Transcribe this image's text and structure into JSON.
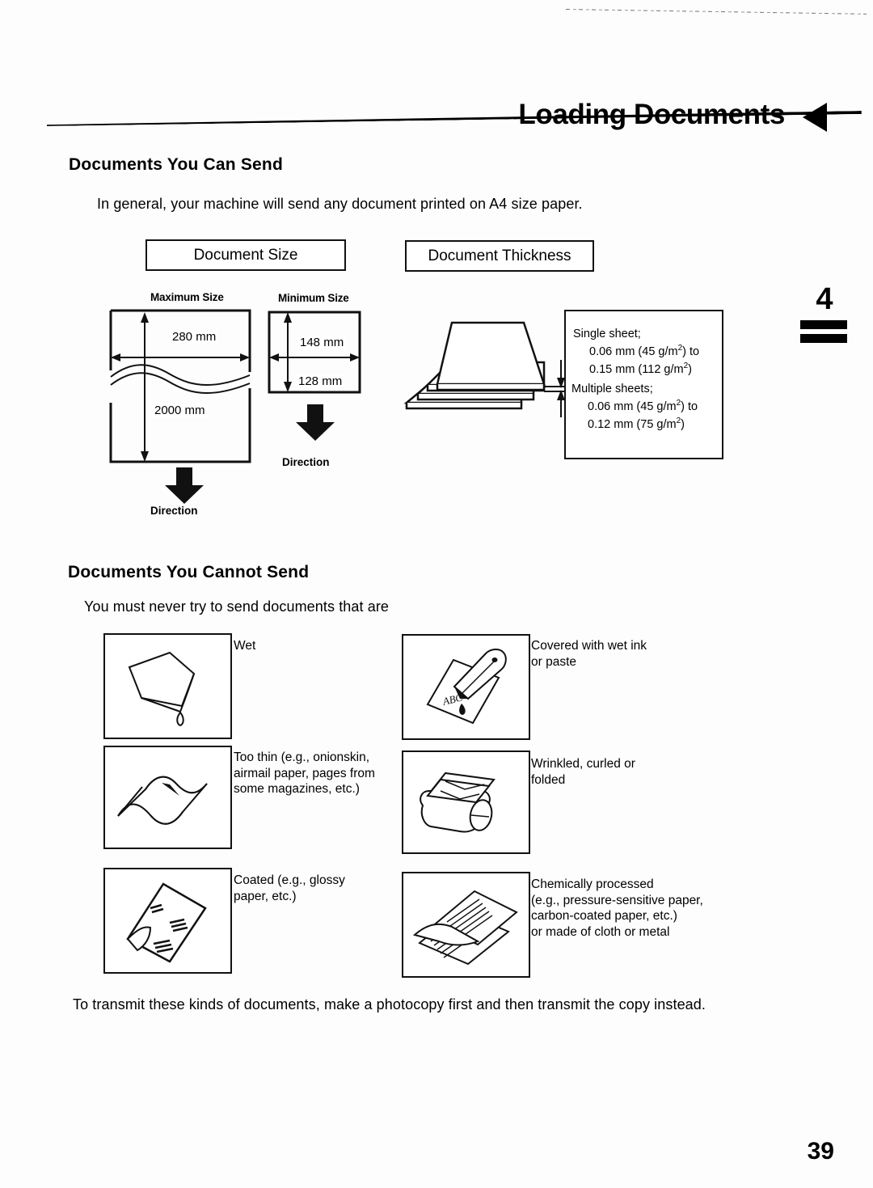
{
  "page": {
    "header_title": "Loading Documents",
    "chapter_number": "4",
    "page_number": "39"
  },
  "can_send": {
    "heading": "Documents You Can Send",
    "intro": "In general, your machine will send any document printed on A4 size paper.",
    "document_size": {
      "label": "Document Size",
      "maximum": {
        "caption": "Maximum Size",
        "width": "280 mm",
        "height": "2000 mm",
        "direction_label": "Direction"
      },
      "minimum": {
        "caption": "Minimum Size",
        "width": "148 mm",
        "height": "128 mm",
        "direction_label": "Direction"
      }
    },
    "document_thickness": {
      "label": "Document Thickness",
      "single": {
        "title": "Single sheet;",
        "line1_a": "0.06 mm (45 g/m",
        "line1_sup": "2",
        "line1_b": ") to",
        "line2_a": "0.15 mm (112 g/m",
        "line2_sup": "2",
        "line2_b": ")"
      },
      "multiple": {
        "title": "Multiple sheets;",
        "line1_a": "0.06 mm (45 g/m",
        "line1_sup": "2",
        "line1_b": ") to",
        "line2_a": "0.12 mm (75 g/m",
        "line2_sup": "2",
        "line2_b": ")"
      }
    }
  },
  "cannot_send": {
    "heading": "Documents You Cannot Send",
    "intro": "You must never try to send documents that are",
    "items": [
      {
        "icon": "wet-paper-icon",
        "caption_lines": [
          "Wet"
        ]
      },
      {
        "icon": "pen-ink-paper-icon",
        "caption_lines": [
          "Covered with wet ink",
          "or paste"
        ]
      },
      {
        "icon": "thin-wavy-paper-icon",
        "caption_lines": [
          "Too thin (e.g., onionskin,",
          "airmail paper, pages from",
          "some magazines, etc.)"
        ]
      },
      {
        "icon": "curled-paper-roll-icon",
        "caption_lines": [
          "Wrinkled, curled or",
          "folded"
        ]
      },
      {
        "icon": "glossy-paper-icon",
        "caption_lines": [
          "Coated (e.g., glossy",
          "paper, etc.)"
        ]
      },
      {
        "icon": "carbon-paper-icon",
        "caption_lines": [
          "Chemically processed",
          "(e.g., pressure-sensitive paper,",
          "carbon-coated paper, etc.)",
          "or made of cloth or metal"
        ]
      }
    ],
    "footer": "To transmit these kinds of documents, make a photocopy first and then transmit the copy instead."
  }
}
